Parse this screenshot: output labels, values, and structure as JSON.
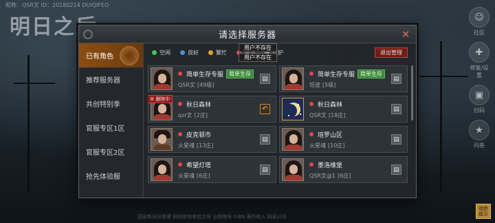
{
  "background": {
    "game_logo": "明日之后",
    "player_info": "昵称：QSR文 ID：20180214 DUIQIFEO"
  },
  "right_rail": [
    {
      "icon": "face-icon",
      "label": "社区"
    },
    {
      "icon": "gift-icon",
      "label": "修复/设置"
    },
    {
      "icon": "scan-icon",
      "label": "扫码"
    },
    {
      "icon": "star-icon",
      "label": "问卷"
    }
  ],
  "corner_badge": "适龄提示",
  "footer_text": "国家新闻出版署 网络游戏审批文号 出版物号 ISBN 著作权人 网易公司",
  "modal": {
    "title": "请选择服务器",
    "close_icon": "close-icon"
  },
  "sidebar": {
    "items": [
      {
        "label": "已有角色",
        "active": true
      },
      {
        "label": "推荐服务器",
        "active": false
      },
      {
        "label": "共创特别季",
        "active": false
      },
      {
        "label": "官服专区1区",
        "active": false
      },
      {
        "label": "官服专区2区",
        "active": false
      },
      {
        "label": "抢先体验服",
        "active": false
      }
    ]
  },
  "legend": [
    {
      "label": "空闲",
      "color": "#3fc65a"
    },
    {
      "label": "良好",
      "color": "#4a90d9"
    },
    {
      "label": "繁忙",
      "color": "#e0a030"
    },
    {
      "label": "爆满",
      "color": "#e04848"
    },
    {
      "label": "维护",
      "color": "#bdbdbd"
    }
  ],
  "tooltip": [
    "用户不存在",
    "用户不存在"
  ],
  "exit_button": "退出管理",
  "servers": [
    {
      "name": "简单生存专服",
      "tag": "简单生存",
      "role": "QSR文",
      "level": "[49级]",
      "avatar": "female",
      "action": "trash",
      "deleting": null
    },
    {
      "name": "简单生存专服",
      "tag": "简单生存",
      "role": "坦途",
      "level": "[5级]",
      "avatar": "female",
      "action": "trash",
      "deleting": null
    },
    {
      "name": "秋日森林",
      "tag": null,
      "role": "qsr文",
      "level": "[2庄]",
      "avatar": "female",
      "action": "undo",
      "deleting": "删除中"
    },
    {
      "name": "秋日森林",
      "tag": null,
      "role": "QSR文",
      "level": "[18庄]",
      "avatar": "moon",
      "action": "trash",
      "deleting": null
    },
    {
      "name": "皮克顿市",
      "tag": null,
      "role": "火星魂",
      "level": "[13庄]",
      "avatar": "male",
      "action": "trash",
      "deleting": null
    },
    {
      "name": "培罗山区",
      "tag": null,
      "role": "火星魂",
      "level": "[10庄]",
      "avatar": "female",
      "action": "trash",
      "deleting": null
    },
    {
      "name": "希望灯塔",
      "tag": null,
      "role": "火星魂",
      "level": "[6庄]",
      "avatar": "female",
      "action": "trash",
      "deleting": null
    },
    {
      "name": "墨洛维堡",
      "tag": null,
      "role": "QSR文@1",
      "level": "[6庄]",
      "avatar": "female",
      "action": "trash",
      "deleting": null
    }
  ]
}
